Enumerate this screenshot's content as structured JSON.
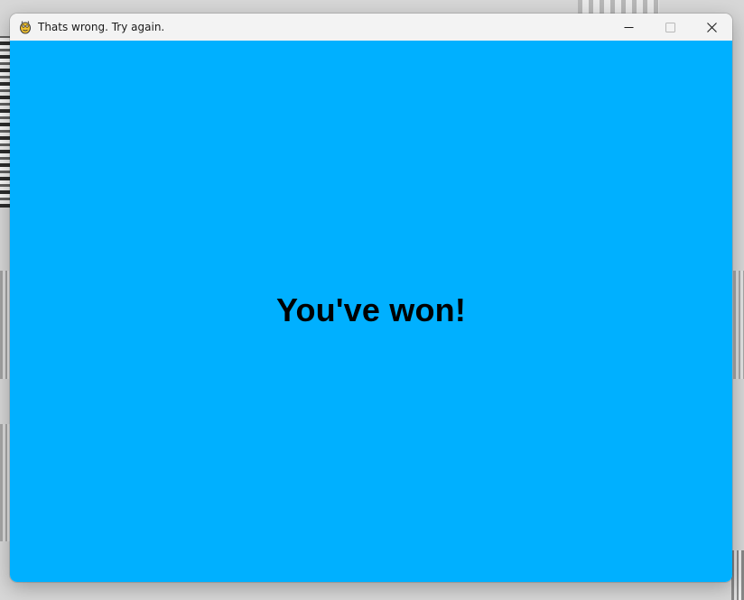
{
  "window": {
    "title": "Thats wrong. Try again.",
    "app_icon": "pygame-snake-icon"
  },
  "controls": {
    "minimize_icon": "minimize-icon",
    "maximize_icon": "maximize-icon",
    "close_icon": "close-icon"
  },
  "content": {
    "message": "You've won!",
    "background_color": "#00b0ff",
    "text_color": "#000000"
  }
}
